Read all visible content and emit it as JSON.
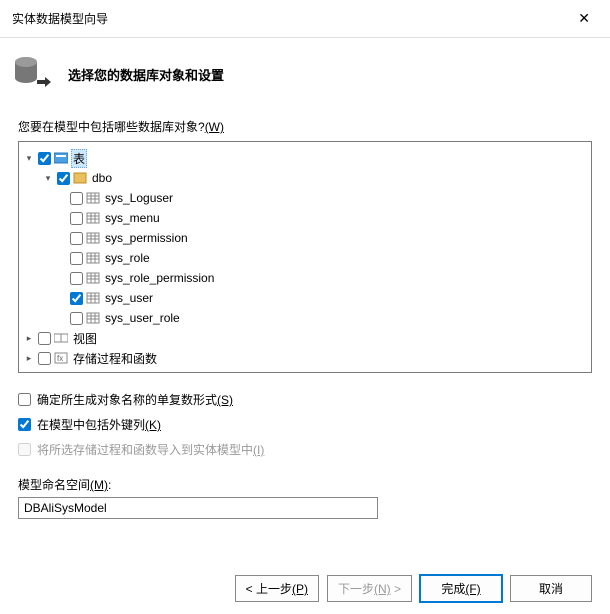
{
  "window": {
    "title": "实体数据模型向导"
  },
  "header": {
    "title": "选择您的数据库对象和设置"
  },
  "prompt": {
    "text": "您要在模型中包括哪些数据库对象?",
    "mnemonic": "(W)"
  },
  "tree": {
    "root": {
      "label": "表",
      "checked": true
    },
    "schema": {
      "label": "dbo",
      "checked": true
    },
    "tables": [
      {
        "label": "sys_Loguser",
        "checked": false
      },
      {
        "label": "sys_menu",
        "checked": false
      },
      {
        "label": "sys_permission",
        "checked": false
      },
      {
        "label": "sys_role",
        "checked": false
      },
      {
        "label": "sys_role_permission",
        "checked": false
      },
      {
        "label": "sys_user",
        "checked": true
      },
      {
        "label": "sys_user_role",
        "checked": false
      }
    ],
    "views": {
      "label": "视图"
    },
    "procs": {
      "label": "存储过程和函数"
    }
  },
  "options": {
    "pluralize": {
      "label": "确定所生成对象名称的单复数形式",
      "mnemonic": "(S)",
      "checked": false
    },
    "fkcols": {
      "label": "在模型中包括外键列",
      "mnemonic": "(K)",
      "checked": true
    },
    "importprocs": {
      "label": "将所选存储过程和函数导入到实体模型中",
      "mnemonic": "(I)",
      "checked": false
    }
  },
  "namespace": {
    "label": "模型命名空间",
    "mnemonic": "(M)",
    "value": "DBAliSysModel"
  },
  "buttons": {
    "prev": {
      "label": "< 上一步",
      "mnemonic": "(P)"
    },
    "next": {
      "label": "下一步",
      "mnemonic": "(N)",
      "suffix": " >"
    },
    "finish": {
      "label": "完成",
      "mnemonic": "(F)"
    },
    "cancel": {
      "label": "取消"
    }
  }
}
